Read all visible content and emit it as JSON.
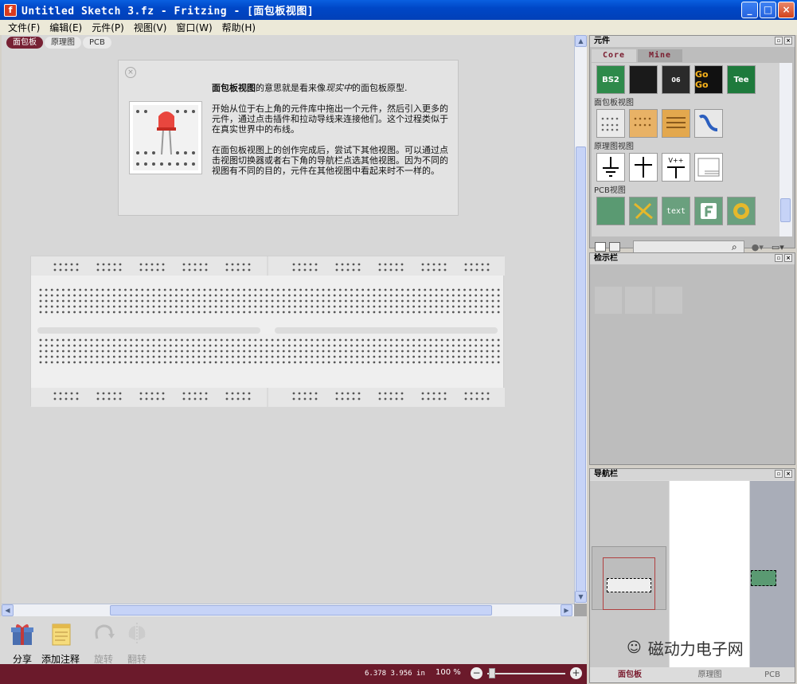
{
  "window": {
    "title": "Untitled Sketch 3.fz - Fritzing - [面包板视图]",
    "controls": [
      "_",
      "□",
      "×"
    ]
  },
  "menu": [
    "文件(F)",
    "编辑(E)",
    "元件(P)",
    "视图(V)",
    "窗口(W)",
    "帮助(H)"
  ],
  "view_tabs": [
    "面包板",
    "原理图",
    "PCB"
  ],
  "welcome": {
    "heading_bold": "面包板视图",
    "heading_rest": "的意思就是看来像",
    "heading_italic": "现实中",
    "heading_end": "的面包板原型.",
    "para1": "开始从位于右上角的元件库中拖出一个元件，然后引入更多的元件，通过点击插件和拉动导线来连接他们。这个过程类似于在真实世界中的布线。",
    "para2": "在面包板视图上的创作完成后，尝试下其他视图。可以通过点击视图切换器或者右下角的导航栏点选其他视图。因为不同的视图有不同的目的，元件在其他视图中看起来时不一样的。"
  },
  "toolbar": {
    "share": "分享",
    "add_note": "添加注释",
    "rotate": "旋转",
    "flip": "翻转"
  },
  "status": {
    "coords": "6.378  3.956  in",
    "zoom": "100 %"
  },
  "parts_bin": {
    "title": "元件",
    "tabs": [
      "Core",
      "Mine"
    ],
    "top_tiles": [
      "BS2",
      "",
      "06",
      "Go Go",
      "Tee"
    ],
    "sections": {
      "breadboard": "面包板视图",
      "schematic": "原理图视图",
      "pcb": "PCB视图"
    },
    "schematic_tile_text": "V++",
    "pcb_tile_text": "text"
  },
  "inspector": {
    "title": "检示栏"
  },
  "navigator": {
    "title": "导航栏",
    "labels": [
      "面包板",
      "原理图",
      "PCB"
    ]
  },
  "watermark": "磁动力电子网"
}
